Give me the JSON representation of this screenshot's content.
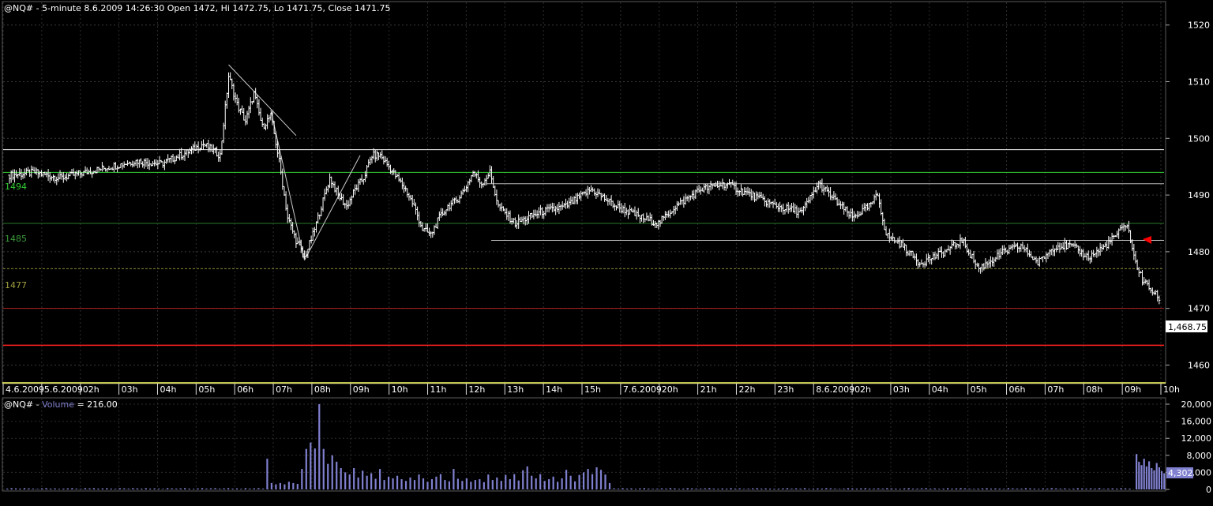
{
  "price_pane": {
    "header": "@NQ# - 5-minute 8.6.2009 14:26:30 Open 1472, Hi 1472.75, Lo 1471.75, Close 1471.75",
    "last_price_label": "1,468.75",
    "level_labels": [
      "1494",
      "1485",
      "1477"
    ]
  },
  "volume_pane": {
    "header_prefix": "@NQ# - ",
    "header_series": "Volume",
    "header_suffix": " = 216.00",
    "last_volume_label": "4,302"
  },
  "colors": {
    "background": "#000000",
    "price_bars": "#ffffff",
    "grid": "#3a3a3a",
    "volume": "#8080d0",
    "level_1494": "#33cc33",
    "level_1485": "#2a7a2a",
    "level_1477": "#8a8a3a",
    "level_1470": "#b02020",
    "level_1463": "#ff2020",
    "level_1498": "#ffffff",
    "date_axis_highlight": "#ffff66",
    "arrow": "#ff0000"
  },
  "chart_data": [
    {
      "type": "ohlc",
      "title": "@NQ# - 5-minute 8.6.2009 14:26:30 Open 1472, Hi 1472.75, Lo 1471.75, Close 1471.75",
      "ylim": [
        1457,
        1524
      ],
      "y_ticks": [
        "1460",
        "1470",
        "1480",
        "1490",
        "1500",
        "1510",
        "1520"
      ],
      "x_tick_labels": [
        "4.6.2009",
        "5.6.2009",
        "02h",
        "03h",
        "04h",
        "05h",
        "06h",
        "07h",
        "08h",
        "09h",
        "10h",
        "11h",
        "12h",
        "13h",
        "14h",
        "15h",
        "7.6.2009",
        "20h",
        "21h",
        "22h",
        "23h",
        "8.6.2009",
        "02h",
        "03h",
        "04h",
        "05h",
        "06h",
        "07h",
        "08h",
        "09h",
        "10h"
      ],
      "close_path": [
        [
          0,
          1493.5
        ],
        [
          15,
          1494
        ],
        [
          30,
          1493
        ],
        [
          45,
          1494
        ],
        [
          60,
          1495
        ],
        [
          75,
          1496
        ],
        [
          90,
          1495.5
        ],
        [
          105,
          1497.5
        ],
        [
          115,
          1499
        ],
        [
          125,
          1497
        ],
        [
          130,
          1511
        ],
        [
          135,
          1506
        ],
        [
          140,
          1503
        ],
        [
          145,
          1508
        ],
        [
          150,
          1502
        ],
        [
          155,
          1504
        ],
        [
          160,
          1496
        ],
        [
          165,
          1486
        ],
        [
          170,
          1482
        ],
        [
          175,
          1479
        ],
        [
          180,
          1483
        ],
        [
          185,
          1488
        ],
        [
          190,
          1493
        ],
        [
          195,
          1490
        ],
        [
          200,
          1488
        ],
        [
          205,
          1491
        ],
        [
          210,
          1493
        ],
        [
          215,
          1497
        ],
        [
          220,
          1497
        ],
        [
          225,
          1495
        ],
        [
          230,
          1493
        ],
        [
          235,
          1491
        ],
        [
          240,
          1488
        ],
        [
          245,
          1484
        ],
        [
          250,
          1483
        ],
        [
          255,
          1486
        ],
        [
          260,
          1488
        ],
        [
          265,
          1489
        ],
        [
          270,
          1491
        ],
        [
          275,
          1494
        ],
        [
          280,
          1492
        ],
        [
          285,
          1494
        ],
        [
          290,
          1488
        ],
        [
          300,
          1485
        ],
        [
          315,
          1487
        ],
        [
          330,
          1488
        ],
        [
          345,
          1491
        ],
        [
          360,
          1488
        ],
        [
          375,
          1486
        ],
        [
          385,
          1485
        ],
        [
          395,
          1488
        ],
        [
          410,
          1491
        ],
        [
          425,
          1492
        ],
        [
          440,
          1490
        ],
        [
          455,
          1488
        ],
        [
          470,
          1487
        ],
        [
          480,
          1492
        ],
        [
          490,
          1489
        ],
        [
          500,
          1486
        ],
        [
          510,
          1488
        ],
        [
          515,
          1490
        ],
        [
          520,
          1483
        ],
        [
          530,
          1481
        ],
        [
          540,
          1478
        ],
        [
          555,
          1480
        ],
        [
          565,
          1482
        ],
        [
          575,
          1477
        ],
        [
          590,
          1480
        ],
        [
          600,
          1481
        ],
        [
          610,
          1478
        ],
        [
          620,
          1481
        ],
        [
          630,
          1481
        ],
        [
          640,
          1479
        ],
        [
          650,
          1481
        ],
        [
          660,
          1484
        ],
        [
          663,
          1485
        ],
        [
          667,
          1479
        ],
        [
          672,
          1475
        ],
        [
          678,
          1473
        ],
        [
          682,
          1471.75
        ]
      ],
      "annotations": {
        "horizontal_levels": [
          1498,
          1494,
          1492,
          1485,
          1482,
          1477,
          1470,
          1463.5
        ],
        "trend_line_from_high": [
          [
            130,
            1513
          ],
          [
            170,
            1500.5
          ]
        ],
        "trend_line_down": [
          [
            155,
            1505
          ],
          [
            175,
            1478.5
          ]
        ],
        "trend_line_up": [
          [
            175,
            1478.5
          ],
          [
            208,
            1497
          ]
        ]
      }
    },
    {
      "type": "bar",
      "title": "@NQ# - Volume = 216.00",
      "ylim": [
        0,
        20000
      ],
      "y_ticks": [
        "0",
        "4,000",
        "8,000",
        "12,000",
        "16,000",
        "20,000"
      ],
      "series": [
        {
          "name": "Volume",
          "values": [
            200,
            300,
            250,
            200,
            300,
            250,
            200,
            150,
            250,
            300,
            200,
            250,
            150,
            200,
            250,
            300,
            200,
            150,
            300,
            250,
            300,
            200,
            250,
            300,
            200,
            150,
            300,
            250,
            200,
            300,
            250,
            200,
            300,
            200,
            250,
            200,
            150,
            300,
            250,
            200,
            250,
            300,
            200,
            150,
            250,
            300,
            200,
            250,
            300,
            200,
            250,
            300,
            200,
            250,
            150,
            300,
            200,
            250,
            300,
            200,
            7200,
            1500,
            1200,
            1500,
            1200,
            1800,
            1500,
            1300,
            4800,
            9500,
            11000,
            9600,
            20000,
            9500,
            6000,
            8000,
            6500,
            5000,
            4000,
            3500,
            5000,
            2800,
            4400,
            3200,
            3800,
            2500,
            4800,
            2200,
            3000,
            2600,
            3200,
            2400,
            2000,
            2800,
            2200,
            3500,
            2600,
            1800,
            2400,
            3000,
            3600,
            2200,
            1900,
            4800,
            2500,
            2000,
            2600,
            1800,
            2200,
            2400,
            1700,
            3500,
            2200,
            2800,
            2000,
            3400,
            2400,
            3600,
            2100,
            4500,
            5400,
            3200,
            2600,
            3600,
            2000,
            2400,
            3000,
            1800,
            2600,
            4600,
            3200,
            1900,
            3400,
            4000,
            4800,
            3600,
            5200,
            4600,
            3500,
            1500,
            250,
            200,
            300,
            200,
            250,
            150,
            250,
            300,
            200,
            150,
            200,
            250,
            200,
            300,
            250,
            150,
            200,
            300,
            250,
            200,
            200,
            250,
            300,
            200,
            150,
            250,
            200,
            300,
            200,
            250,
            150,
            200,
            250,
            300,
            200,
            250,
            200,
            150,
            200,
            250,
            300,
            200,
            250,
            200,
            300,
            150,
            200,
            250,
            200,
            300,
            250,
            200,
            150,
            200,
            300,
            250,
            200,
            250,
            300,
            200,
            200,
            250,
            200,
            300,
            250,
            200,
            150,
            250,
            300,
            200,
            200,
            250,
            300,
            200,
            250,
            150,
            200,
            300,
            200,
            250,
            300,
            250,
            200,
            150,
            200,
            250,
            300,
            200,
            250,
            200,
            150,
            300,
            250,
            200,
            200,
            300,
            250,
            200,
            150,
            250,
            200,
            300,
            250,
            200,
            250,
            150,
            200,
            300,
            250,
            200,
            250,
            200,
            300,
            150,
            200,
            250,
            200,
            300,
            250,
            200,
            8300,
            6500,
            5700,
            7200,
            5400,
            6600,
            5000,
            4500,
            6200,
            5200,
            4302,
            3800
          ]
        }
      ]
    }
  ]
}
